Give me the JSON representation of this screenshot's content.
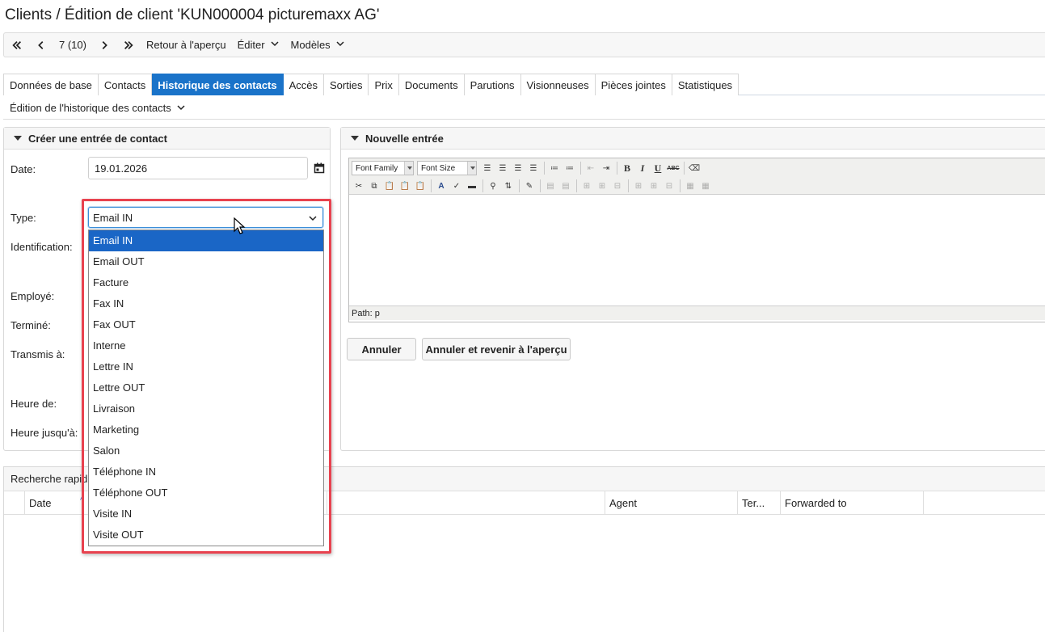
{
  "page": {
    "title": "Clients / Édition de client 'KUN000004 picturemaxx AG'"
  },
  "toolbar": {
    "record_position": "7 (10)",
    "back_to_overview": "Retour à l'aperçu",
    "edit_menu": "Éditer",
    "templates_menu": "Modèles"
  },
  "tabs": [
    {
      "label": "Données de base"
    },
    {
      "label": "Contacts"
    },
    {
      "label": "Historique des contacts",
      "active": true
    },
    {
      "label": "Accès"
    },
    {
      "label": "Sorties"
    },
    {
      "label": "Prix"
    },
    {
      "label": "Documents"
    },
    {
      "label": "Parutions"
    },
    {
      "label": "Visionneuses"
    },
    {
      "label": "Pièces jointes"
    },
    {
      "label": "Statistiques"
    }
  ],
  "subbar": {
    "label": "Édition de l'historique des contacts"
  },
  "create_panel": {
    "title": "Créer une entrée de contact",
    "labels": {
      "date": "Date:",
      "type": "Type:",
      "identification": "Identification:",
      "employee": "Employé:",
      "done": "Terminé:",
      "forwarded": "Transmis à:",
      "time_from": "Heure de:",
      "time_to": "Heure jusqu'à:"
    },
    "date_value": "19.01.2026",
    "type_value": "Email IN",
    "type_options": [
      "Email IN",
      "Email OUT",
      "Facture",
      "Fax IN",
      "Fax OUT",
      "Interne",
      "Lettre IN",
      "Lettre OUT",
      "Livraison",
      "Marketing",
      "Salon",
      "Téléphone IN",
      "Téléphone OUT",
      "Visite IN",
      "Visite OUT"
    ]
  },
  "new_entry_panel": {
    "title": "Nouvelle entrée",
    "font_family": "Font Family",
    "font_size": "Font Size",
    "path": "Path: p",
    "cancel_button": "Annuler",
    "cancel_back_button": "Annuler et revenir à l'aperçu"
  },
  "quick_search": {
    "title": "Recherche rapide",
    "columns": [
      "Date",
      "Agent",
      "Ter...",
      "Forwarded to"
    ]
  },
  "colors": {
    "accent": "#1a73c9",
    "highlight_frame": "#e8424f",
    "selected_option": "#1a66c6"
  }
}
